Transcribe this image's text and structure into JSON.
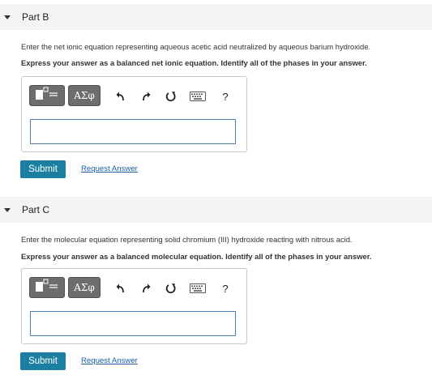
{
  "parts": [
    {
      "title": "Part B",
      "instruction": "Enter the net ionic equation representing aqueous acetic acid neutralized by aqueous barium hydroxide.",
      "emphasis": "Express your answer as a balanced net ionic equation. Identify all of the phases in your answer.",
      "toolbar": {
        "symbols_label": "ΑΣφ",
        "help_label": "?"
      },
      "answer_value": "",
      "submit_label": "Submit",
      "request_label": "Request Answer"
    },
    {
      "title": "Part C",
      "instruction": "Enter the molecular equation representing solid chromium (III) hydroxide reacting with nitrous acid.",
      "emphasis": "Express your answer as a balanced molecular equation. Identify all of the phases in your answer.",
      "toolbar": {
        "symbols_label": "ΑΣφ",
        "help_label": "?"
      },
      "answer_value": "",
      "submit_label": "Submit",
      "request_label": "Request Answer"
    }
  ],
  "colors": {
    "submit_bg": "#1a7fa0",
    "link": "#1a5fa8",
    "toolbar_btn": "#6d6d6d",
    "input_border": "#4a7fb0"
  },
  "icons": [
    "collapse-caret-icon",
    "templates-icon",
    "undo-icon",
    "redo-icon",
    "reset-icon",
    "keyboard-icon",
    "help-icon"
  ]
}
